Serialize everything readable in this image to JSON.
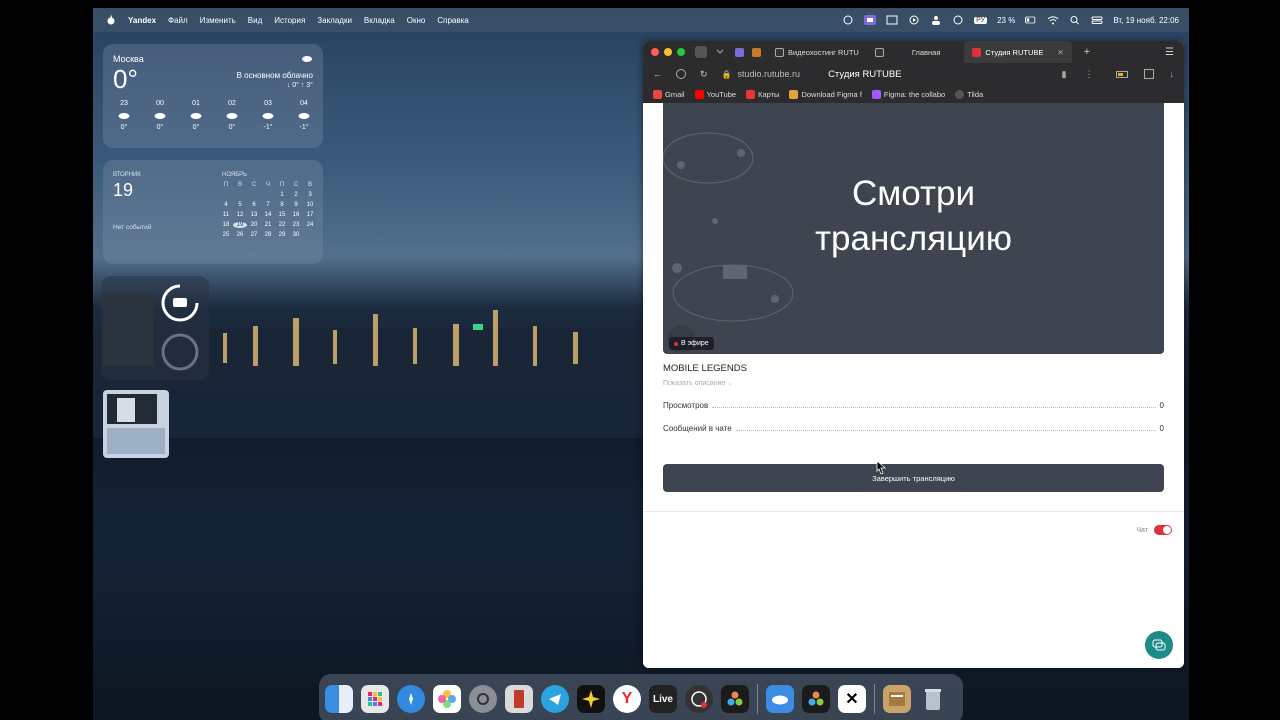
{
  "menubar": {
    "app": "Yandex",
    "items": [
      "Файл",
      "Изменить",
      "Вид",
      "История",
      "Закладки",
      "Вкладка",
      "Окно",
      "Справка"
    ],
    "keyboard": "РУ",
    "battery": "23 %",
    "datetime": "Вт, 19 нояб. 22:06"
  },
  "weather": {
    "city": "Москва",
    "temp": "0°",
    "condition": "В основном облачно",
    "hilo": "↓ 0° ↑ 3°",
    "hours": [
      {
        "time": "23",
        "temp": "0°"
      },
      {
        "time": "00",
        "temp": "0°"
      },
      {
        "time": "01",
        "temp": "0°"
      },
      {
        "time": "02",
        "temp": "0°"
      },
      {
        "time": "03",
        "temp": "-1°"
      },
      {
        "time": "04",
        "temp": "-1°"
      }
    ]
  },
  "calendar": {
    "weekday": "ВТОРНИК",
    "day": "19",
    "no_events": "Нет событий",
    "month": "НОЯБРЬ",
    "headers": [
      "П",
      "В",
      "С",
      "Ч",
      "П",
      "С",
      "В"
    ],
    "weeks": [
      [
        "",
        "",
        "",
        "",
        "1",
        "2",
        "3"
      ],
      [
        "4",
        "5",
        "6",
        "7",
        "8",
        "9",
        "10"
      ],
      [
        "11",
        "12",
        "13",
        "14",
        "15",
        "16",
        "17"
      ],
      [
        "18",
        "19",
        "20",
        "21",
        "22",
        "23",
        "24"
      ],
      [
        "25",
        "26",
        "27",
        "28",
        "29",
        "30",
        ""
      ]
    ],
    "today": "19"
  },
  "browser": {
    "tabs": [
      {
        "label": "Видеохостинг RUTU",
        "active": false
      },
      {
        "label": "Главная",
        "active": false
      },
      {
        "label": "Студия RUTUBE",
        "active": true
      }
    ],
    "url": "studio.rutube.ru",
    "page_title": "Студия RUTUBE",
    "bookmarks": [
      "Gmail",
      "YouTube",
      "Карты",
      "Download Figma f",
      "Figma: the collabo",
      "Tilda"
    ]
  },
  "page": {
    "player_text": "Смотри трансляцию",
    "live_badge": "В эфире",
    "stream_title": "MOBILE LEGENDS",
    "show_description": "Показать описание",
    "stats": [
      {
        "label": "Просмотров",
        "value": "0"
      },
      {
        "label": "Сообщений в чате",
        "value": "0"
      }
    ],
    "end_button": "Завершить трансляцию",
    "chat_label": "Чат",
    "chat_enabled": true
  },
  "dock": {
    "items": [
      "finder-icon",
      "launchpad-icon",
      "safari-icon",
      "photos-icon",
      "settings-icon",
      "files-icon",
      "telegram-icon",
      "notes-icon",
      "yandex-icon",
      "Live",
      "obs-icon",
      "davinci-icon",
      "icloud-icon",
      "davinci2-icon",
      "capcut-icon",
      "archive-icon",
      "trash-icon"
    ]
  },
  "colors": {
    "player_bg": "#3e4550",
    "accent_red": "#e0303c",
    "fab": "#1f8a8a"
  }
}
